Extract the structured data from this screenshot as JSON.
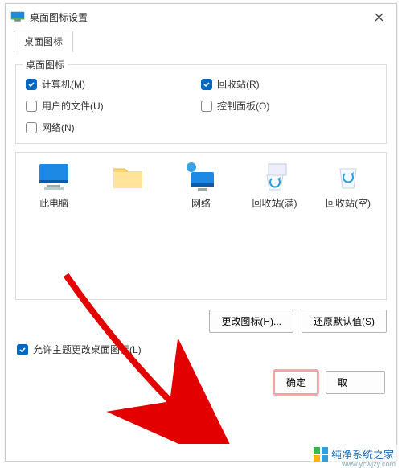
{
  "title": "桌面图标设置",
  "tab_label": "桌面图标",
  "group_legend": "桌面图标",
  "checkboxes": {
    "computer": {
      "label": "计算机(M)",
      "checked": true
    },
    "recycle": {
      "label": "回收站(R)",
      "checked": true
    },
    "userfiles": {
      "label": "用户的文件(U)",
      "checked": false
    },
    "control": {
      "label": "控制面板(O)",
      "checked": false
    },
    "network": {
      "label": "网络(N)",
      "checked": false
    }
  },
  "icons": {
    "thispc": "此电脑",
    "folder": " ",
    "network": "网络",
    "bin_full": "回收站(满)",
    "bin_empty": "回收站(空)"
  },
  "buttons": {
    "change_icon": "更改图标(H)...",
    "restore_default": "还原默认值(S)",
    "ok": "确定",
    "cancel": "取"
  },
  "allow_themes": "允许主题更改桌面图标(L)",
  "watermark": {
    "name": "纯净系统之家",
    "url": "www.ycwjzy.com"
  }
}
